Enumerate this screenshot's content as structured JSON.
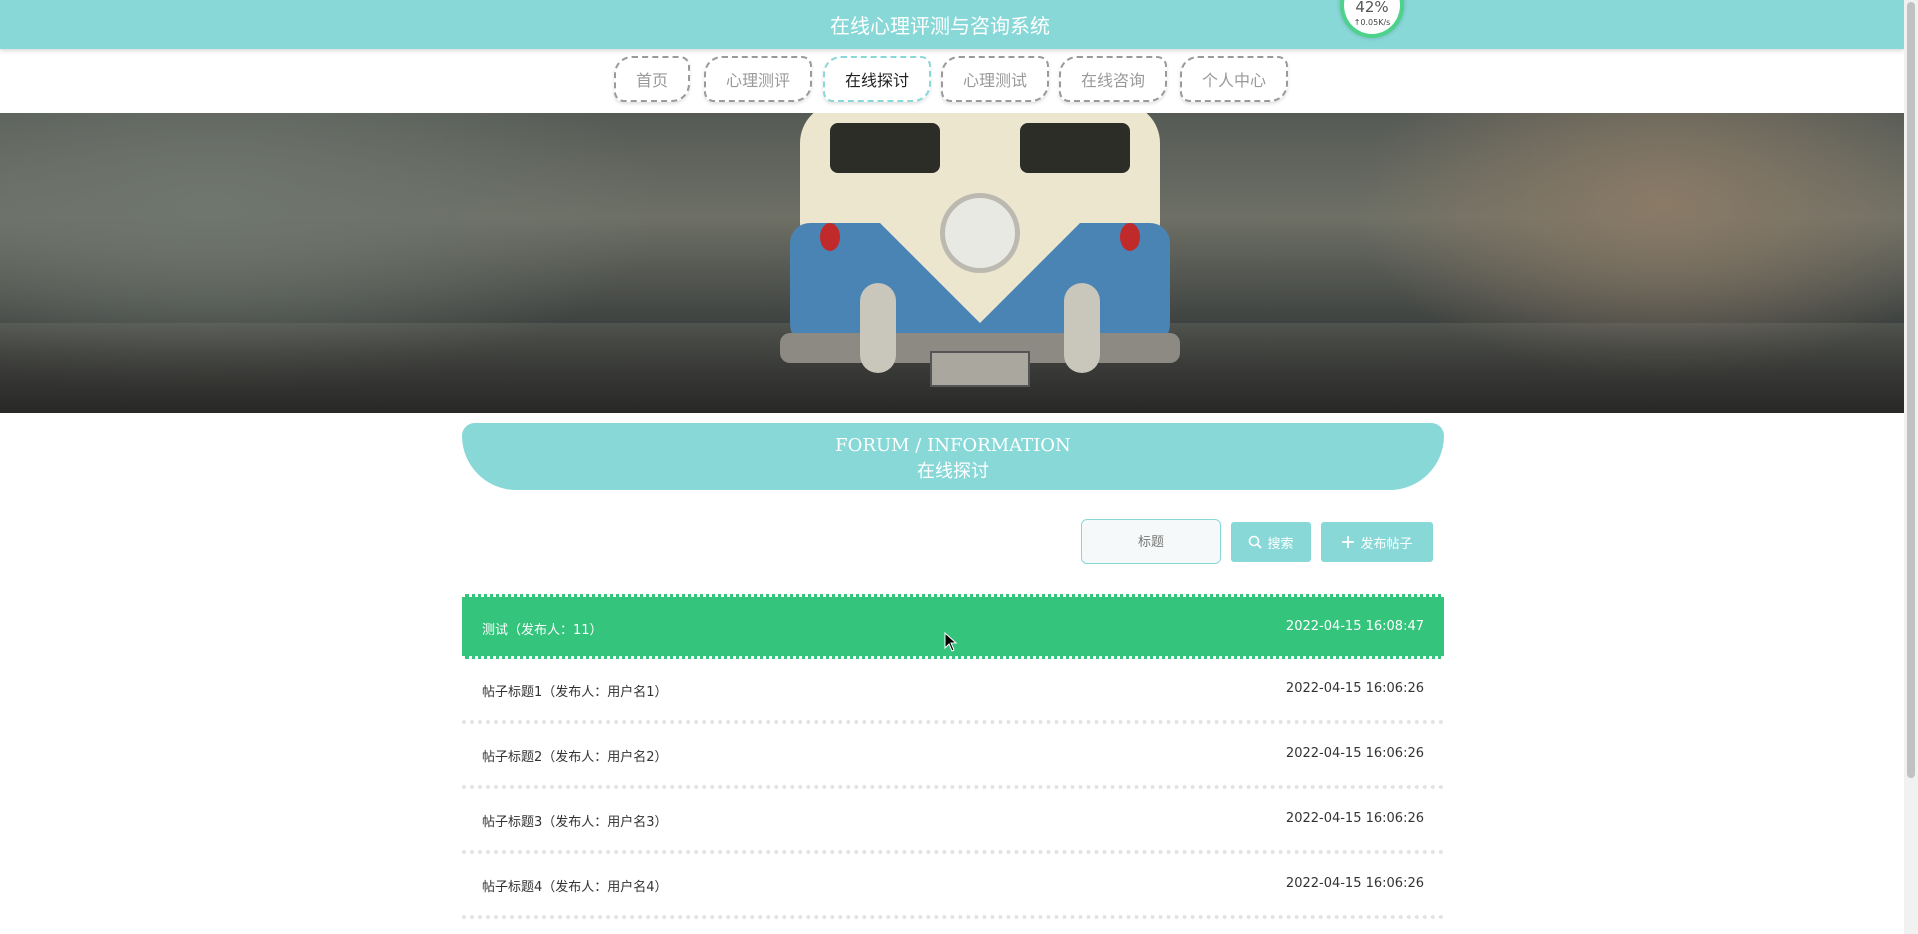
{
  "header": {
    "site_title": "在线心理评测与咨询系统",
    "speed_widget": {
      "percent": "42%",
      "rate": "↑0.05K/s",
      "ring_color": "#4cd28a"
    }
  },
  "nav": {
    "items": [
      {
        "label": "首页",
        "active": false
      },
      {
        "label": "心理测评",
        "active": false
      },
      {
        "label": "在线探讨",
        "active": true
      },
      {
        "label": "心理测试",
        "active": false
      },
      {
        "label": "在线咨询",
        "active": false
      },
      {
        "label": "个人中心",
        "active": false
      }
    ]
  },
  "section": {
    "title_en": "FORUM / INFORMATION",
    "title_cn": "在线探讨"
  },
  "search": {
    "placeholder": "标题",
    "search_label": "搜索",
    "post_label": "发布帖子",
    "search_icon": "search-icon",
    "post_icon": "plus-icon"
  },
  "forum_posts": [
    {
      "title": "测试（发布人：11）",
      "date": "2022-04-15 16:08:47",
      "active": true
    },
    {
      "title": "帖子标题1（发布人：用户名1）",
      "date": "2022-04-15 16:06:26",
      "active": false
    },
    {
      "title": "帖子标题2（发布人：用户名2）",
      "date": "2022-04-15 16:06:26",
      "active": false
    },
    {
      "title": "帖子标题3（发布人：用户名3）",
      "date": "2022-04-15 16:06:26",
      "active": false
    },
    {
      "title": "帖子标题4（发布人：用户名4）",
      "date": "2022-04-15 16:06:26",
      "active": false
    }
  ],
  "colors": {
    "theme": "#88d8d8",
    "active_row": "#34c47c"
  }
}
